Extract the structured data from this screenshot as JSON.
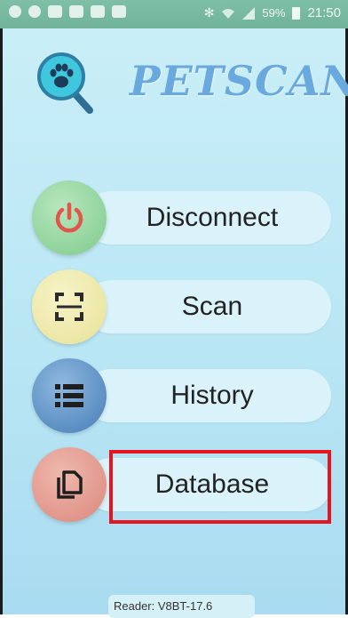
{
  "status_bar": {
    "battery": "59%",
    "time": "21:50",
    "bluetooth_icon": "✻"
  },
  "app": {
    "title": "PETSCAN",
    "logo_icon": "paw-magnifier-icon"
  },
  "menu": [
    {
      "label": "Disconnect",
      "icon": "power-icon",
      "color": "#7fd08c"
    },
    {
      "label": "Scan",
      "icon": "scan-frame-icon",
      "color": "#ece7a5"
    },
    {
      "label": "History",
      "icon": "list-icon",
      "color": "#5b8fc3"
    },
    {
      "label": "Database",
      "icon": "copy-documents-icon",
      "color": "#e1968b"
    }
  ],
  "footer": {
    "reader": "Reader: V8BT-17.6"
  },
  "highlight_color": "#e6141e"
}
